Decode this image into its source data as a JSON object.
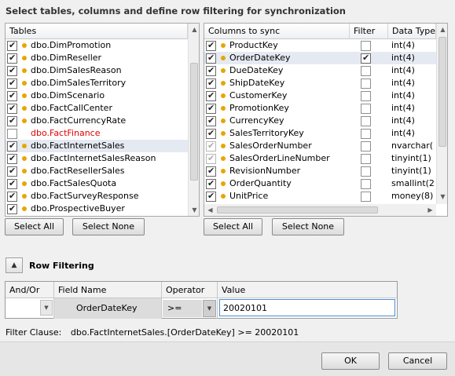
{
  "title": "Select tables, columns and define row filtering for synchronization",
  "tables": {
    "header": "Tables",
    "items": [
      {
        "label": "dbo.DimPromotion",
        "state": "on"
      },
      {
        "label": "dbo.DimReseller",
        "state": "on"
      },
      {
        "label": "dbo.DimSalesReason",
        "state": "on"
      },
      {
        "label": "dbo.DimSalesTerritory",
        "state": "on"
      },
      {
        "label": "dbo.DimScenario",
        "state": "on"
      },
      {
        "label": "dbo.FactCallCenter",
        "state": "on"
      },
      {
        "label": "dbo.FactCurrencyRate",
        "state": "on"
      },
      {
        "label": "dbo.FactFinance",
        "state": "off",
        "error": true
      },
      {
        "label": "dbo.FactInternetSales",
        "state": "on",
        "selected": true
      },
      {
        "label": "dbo.FactInternetSalesReason",
        "state": "on"
      },
      {
        "label": "dbo.FactResellerSales",
        "state": "on"
      },
      {
        "label": "dbo.FactSalesQuota",
        "state": "on"
      },
      {
        "label": "dbo.FactSurveyResponse",
        "state": "on"
      },
      {
        "label": "dbo.ProspectiveBuyer",
        "state": "on"
      }
    ],
    "select_all": "Select All",
    "select_none": "Select None"
  },
  "columns": {
    "headers": [
      "Columns to sync",
      "Filter",
      "Data Type"
    ],
    "items": [
      {
        "name": "ProductKey",
        "state": "on",
        "filter": false,
        "type": "int(4)"
      },
      {
        "name": "OrderDateKey",
        "state": "on",
        "filter": true,
        "type": "int(4)",
        "selected": true
      },
      {
        "name": "DueDateKey",
        "state": "on",
        "filter": false,
        "type": "int(4)"
      },
      {
        "name": "ShipDateKey",
        "state": "on",
        "filter": false,
        "type": "int(4)"
      },
      {
        "name": "CustomerKey",
        "state": "on",
        "filter": false,
        "type": "int(4)"
      },
      {
        "name": "PromotionKey",
        "state": "on",
        "filter": false,
        "type": "int(4)"
      },
      {
        "name": "CurrencyKey",
        "state": "on",
        "filter": false,
        "type": "int(4)"
      },
      {
        "name": "SalesTerritoryKey",
        "state": "on",
        "filter": false,
        "type": "int(4)"
      },
      {
        "name": "SalesOrderNumber",
        "state": "gray",
        "filter": false,
        "type": "nvarchar("
      },
      {
        "name": "SalesOrderLineNumber",
        "state": "gray",
        "filter": false,
        "type": "tinyint(1)"
      },
      {
        "name": "RevisionNumber",
        "state": "on",
        "filter": false,
        "type": "tinyint(1)"
      },
      {
        "name": "OrderQuantity",
        "state": "on",
        "filter": false,
        "type": "smallint(2"
      },
      {
        "name": "UnitPrice",
        "state": "on",
        "filter": false,
        "type": "money(8)"
      }
    ],
    "select_all": "Select All",
    "select_none": "Select None"
  },
  "row_filtering": {
    "label": "Row Filtering",
    "headers": [
      "And/Or",
      "Field Name",
      "Operator",
      "Value"
    ],
    "row": {
      "and_or": "",
      "field": "OrderDateKey",
      "operator": ">=",
      "value": "20020101"
    }
  },
  "filter_clause": {
    "label": "Filter Clause:",
    "text": "dbo.FactInternetSales.[OrderDateKey] >= 20020101"
  },
  "buttons": {
    "ok": "OK",
    "cancel": "Cancel"
  },
  "colors": {
    "accent_dot": "#e6a600",
    "error_text": "#e00000",
    "selection": "#e5eaf2"
  }
}
